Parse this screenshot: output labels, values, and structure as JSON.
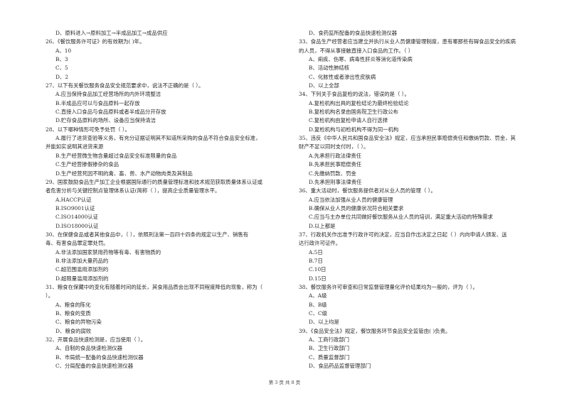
{
  "page": {
    "footer": "第 3 页 共 8 页"
  },
  "left_column": [
    {
      "type": "opt",
      "text": "D、原料进入→原料加工→半成品加工→成品供应"
    },
    {
      "type": "q",
      "text": "26、《餐饮服务许可证》的有效期为(      )年。"
    },
    {
      "type": "opt",
      "text": "A、10"
    },
    {
      "type": "opt",
      "text": "B、3"
    },
    {
      "type": "opt",
      "text": "C、5"
    },
    {
      "type": "opt",
      "text": "D、2"
    },
    {
      "type": "q",
      "text": "27、以下有关餐饮服务食品安全规范要求中，说法不正确的是（        ）。"
    },
    {
      "type": "opt",
      "text": "A.应当保持食品加工经营场所的内外环境整洁"
    },
    {
      "type": "opt",
      "text": "B.半成品应可以与食品原料一起存放"
    },
    {
      "type": "opt",
      "text": "C.直接入口食品与食品原料或者半成品分开存放"
    },
    {
      "type": "opt",
      "text": "D.贮存食品原料的场所、设备应当保持清洁"
    },
    {
      "type": "q",
      "text": "28、以下哪种情形可免予处罚（        ）。"
    },
    {
      "type": "opt",
      "text": "A.履行了进货查验等义务，有充分证据证明其不知道所采购的食品不符合食品安全标准，"
    },
    {
      "type": "q-cont",
      "text": "并能如实说明其进货来源"
    },
    {
      "type": "opt",
      "text": "B.生产经营微生物含量超过食品安全标准限量的食品"
    },
    {
      "type": "opt",
      "text": "C.生产经营掺假掺杂的食品"
    },
    {
      "type": "opt",
      "text": "D.生产经营死因不明的禽、畜、兽、水产动物肉类及其制品"
    },
    {
      "type": "q",
      "text": "29、国家鼓励食品生产加工企业根据国际通行的质量管理标准和技术规范获取质量体系认证或"
    },
    {
      "type": "q-cont",
      "text": "者危害分析与关键控制点管理体系认证(简称（        ），提高企业质量管理水平。"
    },
    {
      "type": "opt",
      "text": "A.HACCP认证"
    },
    {
      "type": "opt",
      "text": "B.ISO9001认证"
    },
    {
      "type": "opt",
      "text": "C.ISO14000认证"
    },
    {
      "type": "opt",
      "text": "D.ISO18000认证"
    },
    {
      "type": "q",
      "text": "30、在保健食品或者其他食品中，（        ），依照刑法第一百四十四条的规定以生产、销售有"
    },
    {
      "type": "q-cont",
      "text": "毒、有害食品罪定罪处罚。"
    },
    {
      "type": "opt",
      "text": "A.非法添加国家禁用药物等有毒、有害物质的"
    },
    {
      "type": "opt",
      "text": "B.非法添加大量药品的"
    },
    {
      "type": "opt",
      "text": "C.超范围滥用添加剂的"
    },
    {
      "type": "opt",
      "text": "D.超限量滥用添加剂的"
    },
    {
      "type": "q",
      "text": "31、粮食在保藏中的变化有随着时间的延长，其食用品质会出现不同程度降低的现象，称为（"
    },
    {
      "type": "q-cont",
      "text": "）。"
    },
    {
      "type": "opt",
      "text": "A、粮食的陈化"
    },
    {
      "type": "opt",
      "text": "B、粮食的变质"
    },
    {
      "type": "opt",
      "text": "C、粮食的异物污染"
    },
    {
      "type": "opt",
      "text": "D、粮食的腐败"
    },
    {
      "type": "q",
      "text": "32、开展食品快速检测是，应当使用（        ）。"
    },
    {
      "type": "opt",
      "text": "A、自制的食品快速检测仪器"
    },
    {
      "type": "opt",
      "text": "B、市局统一配备的食品快速检测仪器"
    },
    {
      "type": "opt",
      "text": "C、分局配备的食品快速检测仪器"
    }
  ],
  "right_column": [
    {
      "type": "opt",
      "text": "D、食药监所配备的食品快速检测仪器"
    },
    {
      "type": "q",
      "text": "33、食品生产经营者应当建立并执行从业人员健康管理制度，患有哪那些有碍食品安全的疾病"
    },
    {
      "type": "q-cont",
      "text": "的人员，不得从事接触直接入口食品的工作。（        ）"
    },
    {
      "type": "opt",
      "text": "A、痢疾、伤寒、病毒性肝炎等消化道传染病"
    },
    {
      "type": "opt",
      "text": "B、活动性肺结核"
    },
    {
      "type": "opt",
      "text": "C、化脓性或者渗出性皮肤病"
    },
    {
      "type": "opt",
      "text": "D、以上全部"
    },
    {
      "type": "q",
      "text": "34、下列关于食品复检的说法，错误的是（        ）。"
    },
    {
      "type": "opt",
      "text": "A.复检机构出具的复检结论为最终检验结论"
    },
    {
      "type": "opt",
      "text": "B.复检机构名录由国务院卫生行政公布"
    },
    {
      "type": "opt",
      "text": "C.复检机构由复检申请人自行选择"
    },
    {
      "type": "opt",
      "text": "D.复检机构与初检机构不得为同一机构"
    },
    {
      "type": "q",
      "text": "35、违反《中华人民共和国食品安全法》规定，应当承担民事赔偿责任和缴纳罚款、罚金，其"
    },
    {
      "type": "q-cont",
      "text": "财产不足以同时支付时，（        ）。"
    },
    {
      "type": "opt",
      "text": "A.先承担行政法律责任"
    },
    {
      "type": "opt",
      "text": "B.先承担民事赔偿责任"
    },
    {
      "type": "opt",
      "text": "C.先缴纳罚款、罚金"
    },
    {
      "type": "opt",
      "text": "D.先承担刑事法律责任"
    },
    {
      "type": "q",
      "text": "36、重大活动时，餐饮服务提供者对从业人员的管理（        ）。"
    },
    {
      "type": "opt",
      "text": "A.应当依法加强从业人员的健康管理"
    },
    {
      "type": "opt",
      "text": "B.确保从业人员的健康状况符合相关要求"
    },
    {
      "type": "opt",
      "text": "C.应当与主办单位共同做好餐饮服务从业人员的培训，满足重大活动的特殊需求"
    },
    {
      "type": "opt",
      "text": "D.以上都是"
    },
    {
      "type": "q",
      "text": "37、行政机关作出准予行政许可的决定，应当自作出决定之日起（        ）内向申请人颁发、送"
    },
    {
      "type": "q-cont",
      "text": "达行政许可证件。"
    },
    {
      "type": "opt",
      "text": "A.5日"
    },
    {
      "type": "opt",
      "text": "B.7日"
    },
    {
      "type": "opt",
      "text": "C.10日"
    },
    {
      "type": "opt",
      "text": "D.15日"
    },
    {
      "type": "q",
      "text": "38、餐饮服务许可审查和日常监督管理量化评价结果均为一般的，评为（        ）。"
    },
    {
      "type": "opt",
      "text": "A、A级"
    },
    {
      "type": "opt",
      "text": "B、B级"
    },
    {
      "type": "opt",
      "text": "C、C级"
    },
    {
      "type": "opt",
      "text": "D、以上均是"
    },
    {
      "type": "q",
      "text": "39、《食品安全法》规定，餐饮服务环节食品安全监管由(        )负责。"
    },
    {
      "type": "opt",
      "text": "A、工商行政部门"
    },
    {
      "type": "opt",
      "text": "B、卫生行政部门"
    },
    {
      "type": "opt",
      "text": "C、质量监督部门"
    },
    {
      "type": "opt",
      "text": "D、食品药品监督管理部门"
    }
  ]
}
